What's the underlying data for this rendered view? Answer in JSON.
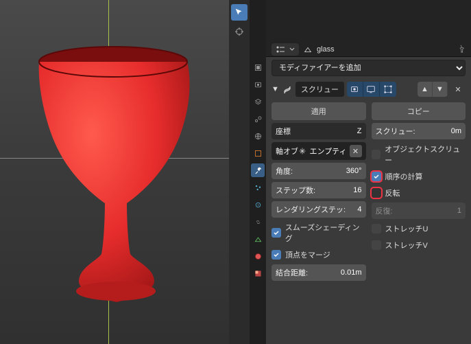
{
  "object_name": "glass",
  "add_modifier_label": "モディファイアーを追加",
  "modifier_name": "スクリュー",
  "apply": "適用",
  "copy": "コピー",
  "left": {
    "axis_label": "座標",
    "axis_value": "Z",
    "axis_obj_label": "軸オブ",
    "axis_obj_value": "エンプティ",
    "angle_label": "角度:",
    "angle_value": "360°",
    "steps_label": "ステップ数:",
    "steps_value": "16",
    "render_steps_label": "レンダリングステッ:",
    "render_steps_value": "4",
    "smooth": "スムーズシェーディング",
    "merge": "頂点をマージ",
    "merge_dist_label": "結合距離:",
    "merge_dist_value": "0.01m"
  },
  "right": {
    "screw_offset_label": "スクリュー:",
    "screw_offset_value": "0m",
    "object_screw": "オブジェクトスクリュー",
    "calc_order": "順序の計算",
    "flip": "反転",
    "iterations_label": "反復:",
    "iterations_value": "1",
    "stretch_u": "ストレッチU",
    "stretch_v": "ストレッチV"
  },
  "colors": {
    "accent": "#4a7db8",
    "goblet": "#e62c2c"
  }
}
